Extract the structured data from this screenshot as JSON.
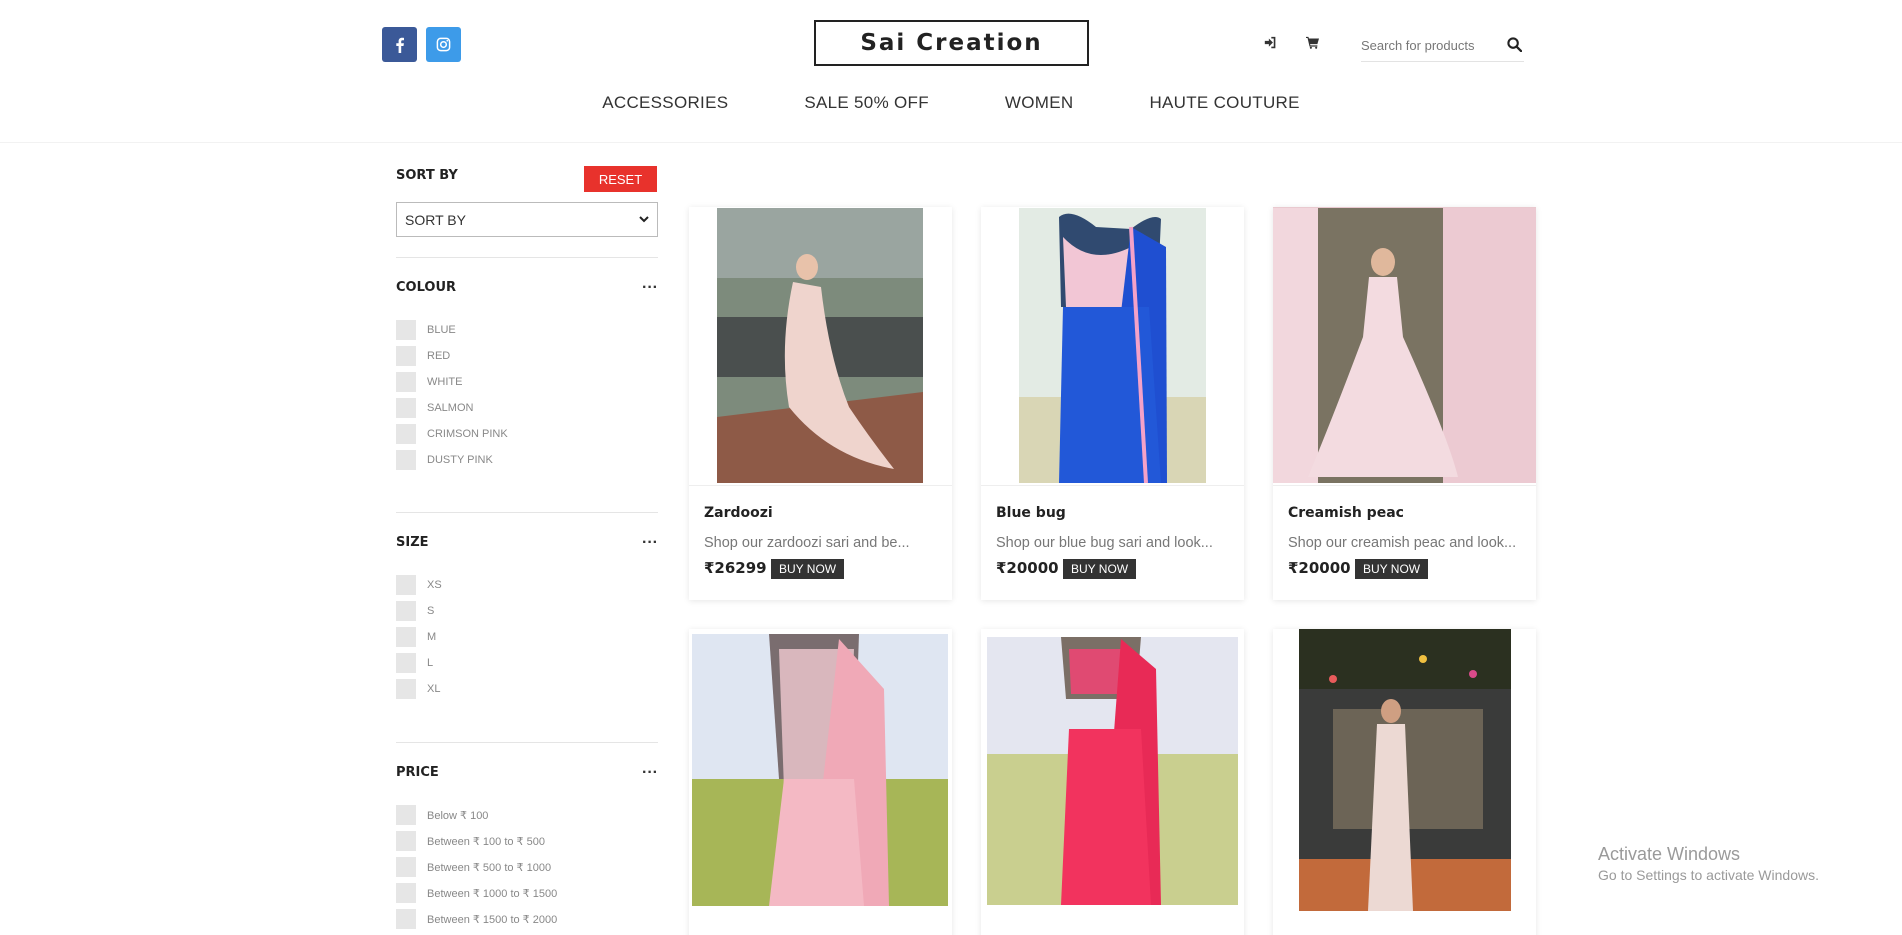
{
  "header": {
    "logo": "Sai Creation",
    "search": {
      "placeholder": "Search for products"
    },
    "icons": [
      "facebook-icon",
      "instagram-icon",
      "login-icon",
      "cart-icon",
      "search-icon"
    ]
  },
  "nav": [
    {
      "label": "ACCESSORIES"
    },
    {
      "label": "SALE 50% OFF"
    },
    {
      "label": "WOMEN"
    },
    {
      "label": "HAUTE COUTURE"
    }
  ],
  "sidebar": {
    "sort_title": "SORT BY",
    "reset_label": "RESET",
    "sort_value": "SORT BY",
    "colour": {
      "title": "COLOUR",
      "options": [
        "BLUE",
        "RED",
        "WHITE",
        "SALMON",
        "CRIMSON PINK",
        "DUSTY PINK"
      ]
    },
    "size": {
      "title": "SIZE",
      "options": [
        "XS",
        "S",
        "M",
        "L",
        "XL"
      ]
    },
    "price": {
      "title": "PRICE",
      "options": [
        "Below ₹ 100",
        "Between ₹ 100 to ₹ 500",
        "Between ₹ 500 to ₹ 1000",
        "Between ₹ 1000 to ₹ 1500",
        "Between ₹ 1500 to ₹ 2000"
      ]
    }
  },
  "products": [
    {
      "name": "Zardoozi",
      "desc": "Shop our zardoozi sari and be...",
      "price": "₹26299",
      "buy": "BUY NOW"
    },
    {
      "name": "Blue bug",
      "desc": "Shop our blue bug sari and look...",
      "price": "₹20000",
      "buy": "BUY NOW"
    },
    {
      "name": "Creamish peac",
      "desc": "Shop our creamish peac and look...",
      "price": "₹20000",
      "buy": "BUY NOW"
    },
    {
      "name": "",
      "desc": "",
      "price": "",
      "buy": ""
    },
    {
      "name": "",
      "desc": "",
      "price": "",
      "buy": ""
    },
    {
      "name": "",
      "desc": "",
      "price": "",
      "buy": ""
    }
  ],
  "watermark": {
    "title": "Activate Windows",
    "subtitle": "Go to Settings to activate Windows."
  },
  "colors": {
    "facebook": "#3b5998",
    "instagram": "#3d9be9",
    "reset": "#e8322c",
    "buy": "#333333"
  }
}
